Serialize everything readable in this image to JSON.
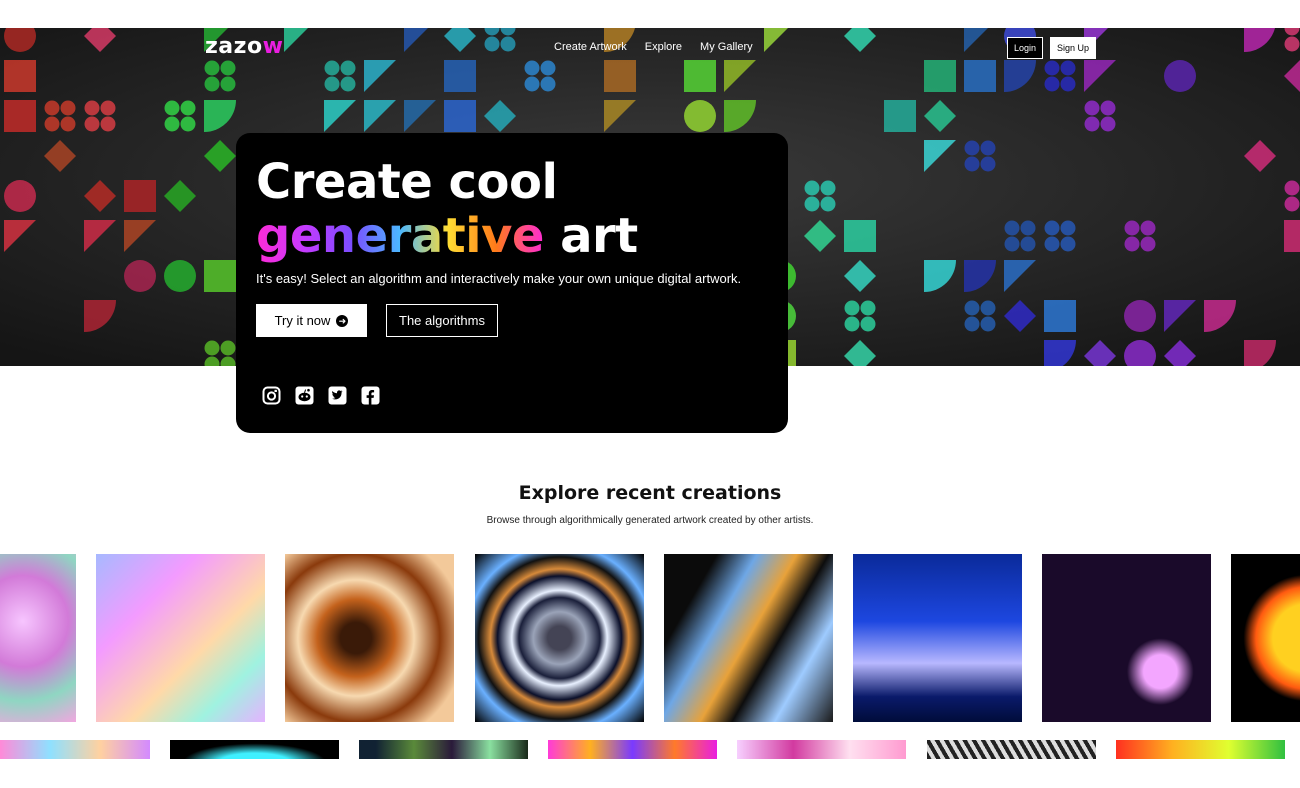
{
  "nav": {
    "logo": "zazo",
    "logo_accent": "w",
    "links": [
      "Create Artwork",
      "Explore",
      "My Gallery"
    ],
    "login": "Login",
    "signup": "Sign Up"
  },
  "hero": {
    "title_line1": "Create cool",
    "title_gen": "generative",
    "title_art": " art",
    "subtitle": "It's easy! Select an algorithm and interactively make your own unique digital artwork.",
    "try_label": "Try it now",
    "algorithms_label": "The algorithms",
    "social_icons": [
      "instagram-icon",
      "reddit-icon",
      "twitter-icon",
      "facebook-icon"
    ]
  },
  "explore": {
    "title": "Explore recent creations",
    "subtitle": "Browse through algorithmically generated artwork created by other artists."
  },
  "colors": {
    "accent": "#e91ee0",
    "card_bg": "#000000",
    "hero_bg": "#2a2a2a"
  }
}
